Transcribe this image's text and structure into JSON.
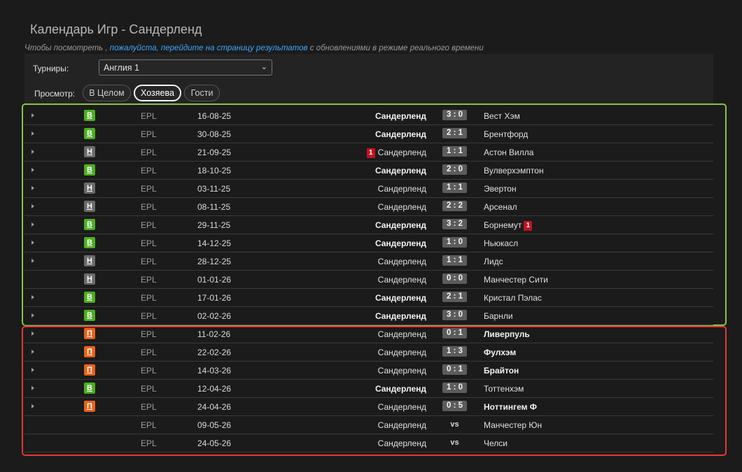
{
  "page": {
    "title": "Календарь Игр - Сандерленд",
    "notice_prefix": "Чтобы посмотреть , ",
    "notice_link": "пожалуйста, перейдите на страницу результатов",
    "notice_suffix": " с обновлениями в режиме реального времени"
  },
  "filters": {
    "tournament_label": "Турниры:",
    "tournament_value": "Англия 1",
    "view_label": "Просмотр:",
    "view_options": [
      "В Целом",
      "Хозяева",
      "Гости"
    ],
    "view_selected": "Хозяева"
  },
  "colors": {
    "win": "#4caf22",
    "draw": "#6b6b6b",
    "loss": "#e8621a",
    "played_border": "#8bc34a",
    "loss_border": "#e53935",
    "red_card": "#c1121f",
    "link": "#3ea6ff"
  },
  "icons": {
    "expand": "caret-right-icon",
    "red_card": "red-card-icon"
  },
  "matches": [
    {
      "expand": true,
      "result": "В",
      "rtype": "w",
      "comp": "EPL",
      "date": "16-08-25",
      "home": "Сандерленд",
      "score": "3 : 0",
      "away": "Вест Хэм",
      "bold": "home"
    },
    {
      "expand": true,
      "result": "В",
      "rtype": "w",
      "comp": "EPL",
      "date": "30-08-25",
      "home": "Сандерленд",
      "score": "2 : 1",
      "away": "Брентфорд",
      "bold": "home"
    },
    {
      "expand": true,
      "result": "Н",
      "rtype": "d",
      "comp": "EPL",
      "date": "21-09-25",
      "home": "Сандерленд",
      "score": "1 : 1",
      "away": "Астон Вилла",
      "bold": "",
      "home_red": "1"
    },
    {
      "expand": true,
      "result": "В",
      "rtype": "w",
      "comp": "EPL",
      "date": "18-10-25",
      "home": "Сандерленд",
      "score": "2 : 0",
      "away": "Вулверхэмптон",
      "bold": "home"
    },
    {
      "expand": true,
      "result": "Н",
      "rtype": "d",
      "comp": "EPL",
      "date": "03-11-25",
      "home": "Сандерленд",
      "score": "1 : 1",
      "away": "Эвертон",
      "bold": ""
    },
    {
      "expand": true,
      "result": "Н",
      "rtype": "d",
      "comp": "EPL",
      "date": "08-11-25",
      "home": "Сандерленд",
      "score": "2 : 2",
      "away": "Арсенал",
      "bold": ""
    },
    {
      "expand": true,
      "result": "В",
      "rtype": "w",
      "comp": "EPL",
      "date": "29-11-25",
      "home": "Сандерленд",
      "score": "3 : 2",
      "away": "Борнемут",
      "bold": "home",
      "away_red": "1"
    },
    {
      "expand": true,
      "result": "В",
      "rtype": "w",
      "comp": "EPL",
      "date": "14-12-25",
      "home": "Сандерленд",
      "score": "1 : 0",
      "away": "Ньюкасл",
      "bold": "home"
    },
    {
      "expand": true,
      "result": "Н",
      "rtype": "d",
      "comp": "EPL",
      "date": "28-12-25",
      "home": "Сандерленд",
      "score": "1 : 1",
      "away": "Лидс",
      "bold": ""
    },
    {
      "expand": false,
      "result": "Н",
      "rtype": "d",
      "comp": "EPL",
      "date": "01-01-26",
      "home": "Сандерленд",
      "score": "0 : 0",
      "away": "Манчестер Сити",
      "bold": ""
    },
    {
      "expand": true,
      "result": "В",
      "rtype": "w",
      "comp": "EPL",
      "date": "17-01-26",
      "home": "Сандерленд",
      "score": "2 : 1",
      "away": "Кристал Пэлас",
      "bold": "home"
    },
    {
      "expand": true,
      "result": "В",
      "rtype": "w",
      "comp": "EPL",
      "date": "02-02-26",
      "home": "Сандерленд",
      "score": "3 : 0",
      "away": "Барнли",
      "bold": "home"
    },
    {
      "expand": true,
      "result": "П",
      "rtype": "l",
      "comp": "EPL",
      "date": "11-02-26",
      "home": "Сандерленд",
      "score": "0 : 1",
      "away": "Ливерпуль",
      "bold": "away"
    },
    {
      "expand": true,
      "result": "П",
      "rtype": "l",
      "comp": "EPL",
      "date": "22-02-26",
      "home": "Сандерленд",
      "score": "1 : 3",
      "away": "Фулхэм",
      "bold": "away"
    },
    {
      "expand": true,
      "result": "П",
      "rtype": "l",
      "comp": "EPL",
      "date": "14-03-26",
      "home": "Сандерленд",
      "score": "0 : 1",
      "away": "Брайтон",
      "bold": "away"
    },
    {
      "expand": true,
      "result": "В",
      "rtype": "w",
      "comp": "EPL",
      "date": "12-04-26",
      "home": "Сандерленд",
      "score": "1 : 0",
      "away": "Тоттенхэм",
      "bold": "home"
    },
    {
      "expand": true,
      "result": "П",
      "rtype": "l",
      "comp": "EPL",
      "date": "24-04-26",
      "home": "Сандерленд",
      "score": "0 : 5",
      "away": "Ноттингем Ф",
      "bold": "away"
    },
    {
      "expand": false,
      "result": "",
      "rtype": "",
      "comp": "EPL",
      "date": "09-05-26",
      "home": "Сандерленд",
      "vs": "vs",
      "away": "Манчестер Юн",
      "bold": ""
    },
    {
      "expand": false,
      "result": "",
      "rtype": "",
      "comp": "EPL",
      "date": "24-05-26",
      "home": "Сандерленд",
      "vs": "vs",
      "away": "Челси",
      "bold": ""
    }
  ]
}
